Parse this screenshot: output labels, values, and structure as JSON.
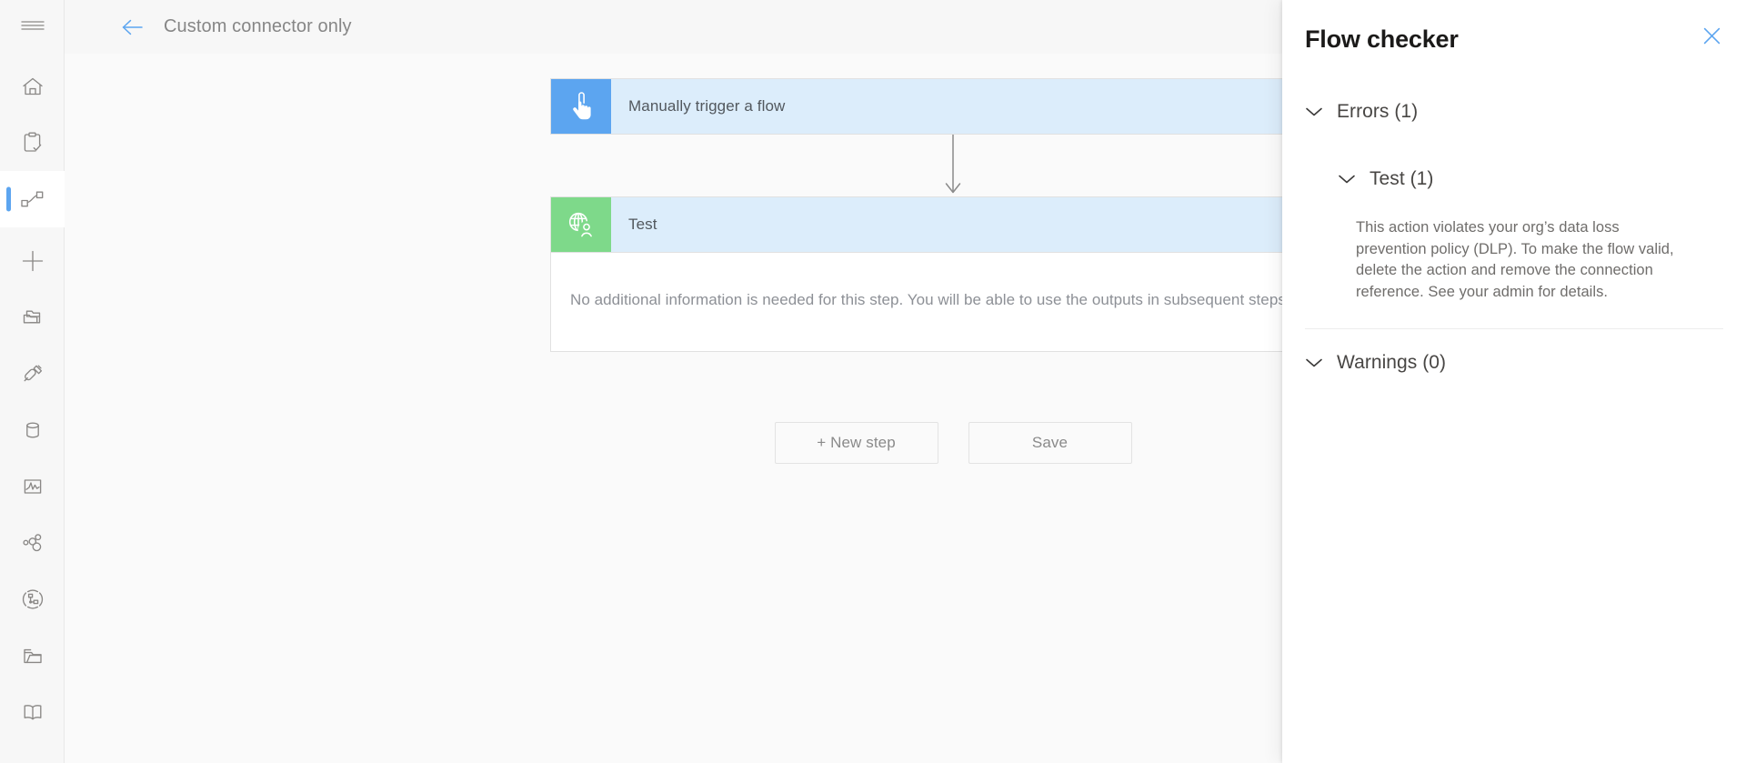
{
  "app": {
    "background_color": "#fafafa",
    "accent_color": "#5ca5f0"
  },
  "rail": {
    "items": [
      {
        "icon": "hamburger-menu-icon",
        "name": "menu-toggle",
        "label": ""
      },
      {
        "icon": "home-icon",
        "name": "sidebar-item-home",
        "label": ""
      },
      {
        "icon": "clipboard-check-icon",
        "name": "sidebar-item-approvals",
        "label": ""
      },
      {
        "icon": "flow-icon",
        "name": "sidebar-item-my-flows",
        "label": "",
        "selected": true
      },
      {
        "icon": "plus-icon",
        "name": "sidebar-item-create",
        "label": ""
      },
      {
        "icon": "templates-icon",
        "name": "sidebar-item-templates",
        "label": ""
      },
      {
        "icon": "connectors-icon",
        "name": "sidebar-item-connectors",
        "label": ""
      },
      {
        "icon": "database-icon",
        "name": "sidebar-item-data",
        "label": ""
      },
      {
        "icon": "ai-builder-icon",
        "name": "sidebar-item-ai-builder",
        "label": ""
      },
      {
        "icon": "solutions-icon",
        "name": "sidebar-item-solutions",
        "label": ""
      },
      {
        "icon": "process-advisor-icon",
        "name": "sidebar-item-process-advisor",
        "label": ""
      },
      {
        "icon": "desktop-flows-icon",
        "name": "sidebar-item-desktop-flows",
        "label": ""
      },
      {
        "icon": "learn-book-icon",
        "name": "sidebar-item-learn",
        "label": ""
      }
    ]
  },
  "header": {
    "back_icon": "back-arrow-icon",
    "title": "Custom connector only"
  },
  "canvas": {
    "trigger_card": {
      "icon": "manual-trigger-hand-icon",
      "icon_bg": "#5ca5f0",
      "title": "Manually trigger a flow",
      "menu_icon": "ellipsis-icon"
    },
    "action_card": {
      "icon": "custom-connector-globe-icon",
      "icon_bg": "#7ed98a",
      "title": "Test",
      "menu_icon": "ellipsis-icon",
      "body_text": "No additional information is needed for this step. You will be able to use the outputs in subsequent steps."
    },
    "connector_icon": "down-arrow-connector-icon",
    "buttons": {
      "new_step": "+ New step",
      "save": "Save"
    }
  },
  "flow_checker": {
    "title": "Flow checker",
    "close_icon": "close-icon",
    "errors": {
      "chevron": "chevron-down-icon",
      "label": "Errors (1)",
      "items": [
        {
          "chevron": "chevron-down-icon",
          "label": "Test (1)",
          "message": "This action violates your org’s data loss prevention policy (DLP). To make the flow valid, delete the action and remove the connection reference. See your admin for details."
        }
      ]
    },
    "warnings": {
      "chevron": "chevron-down-icon",
      "label": "Warnings (0)"
    }
  }
}
